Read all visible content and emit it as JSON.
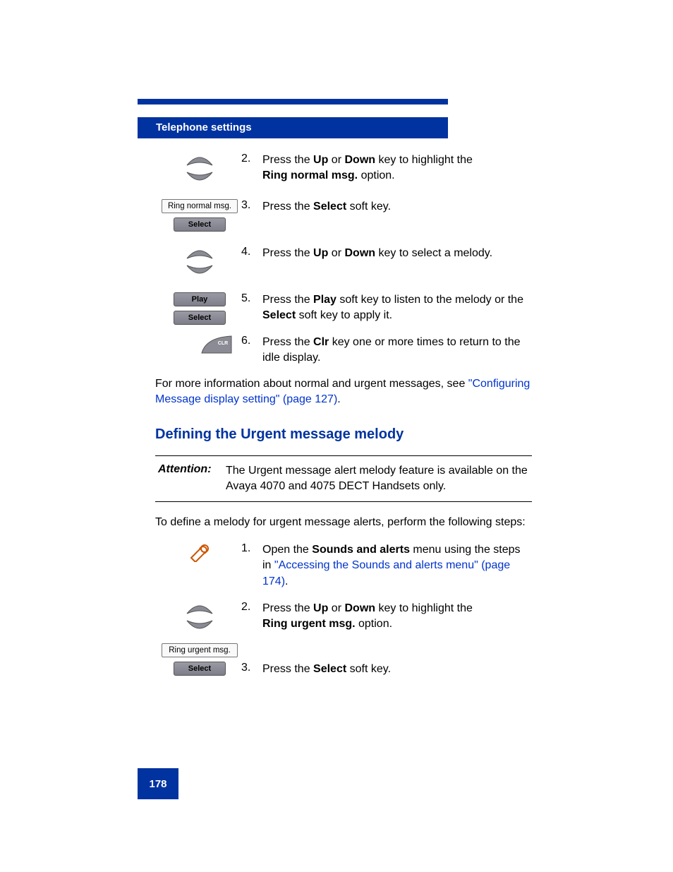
{
  "header": "Telephone settings",
  "pageNumber": "178",
  "steps1": [
    {
      "num": "2.",
      "text": [
        "Press the ",
        " or ",
        " key to highlight the ",
        " option."
      ],
      "bold": [
        "Up",
        "Down",
        "Ring normal msg."
      ]
    },
    {
      "num": "3.",
      "text": [
        "Press the ",
        " soft key."
      ],
      "bold": [
        "Select"
      ]
    },
    {
      "num": "4.",
      "text": [
        "Press the ",
        " or ",
        " key to select a melody."
      ],
      "bold": [
        "Up",
        "Down"
      ]
    },
    {
      "num": "5.",
      "text": [
        "Press the ",
        " soft key to listen to the melody or the ",
        " soft key to apply it."
      ],
      "bold": [
        "Play",
        "Select"
      ]
    },
    {
      "num": "6.",
      "text": [
        "Press the ",
        " key one or more times to return to the idle display."
      ],
      "bold": [
        "Clr"
      ]
    }
  ],
  "para1": "For more information about normal and urgent messages, see ",
  "link1": "\"Configuring Message display setting\" (page 127)",
  "para1End": ".",
  "heading2": "Defining the Urgent message melody",
  "attentionLabel": "Attention:",
  "attentionText": "The Urgent message alert melody feature is available on the Avaya 4070 and 4075 DECT Handsets only.",
  "para2": "To define a melody for urgent message alerts, perform the following steps:",
  "steps2": [
    {
      "num": "1.",
      "text": [
        "Open the ",
        " menu using the steps in "
      ],
      "bold": [
        "Sounds and alerts"
      ],
      "link": "\"Accessing the Sounds and alerts menu\" (page 174)",
      "tail": "."
    },
    {
      "num": "2.",
      "text": [
        "Press the ",
        " or ",
        " key to highlight the ",
        " option."
      ],
      "bold": [
        "Up",
        "Down",
        "Ring urgent msg."
      ]
    },
    {
      "num": "3.",
      "text": [
        "Press the ",
        " soft key."
      ],
      "bold": [
        "Select"
      ]
    }
  ],
  "buttons": {
    "ringNormal": "Ring normal msg.",
    "select": "Select",
    "play": "Play",
    "ringUrgent": "Ring urgent msg."
  }
}
